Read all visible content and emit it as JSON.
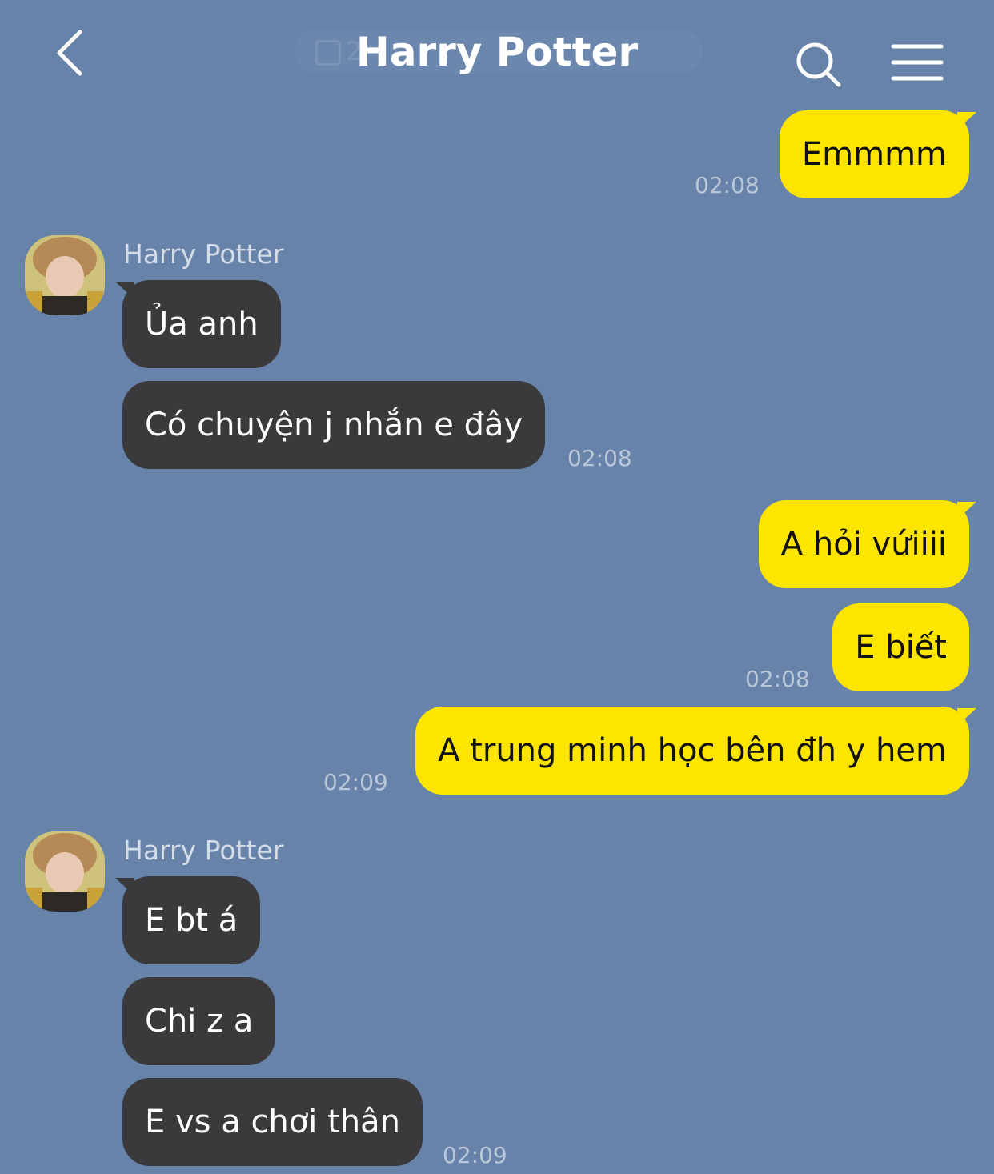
{
  "header": {
    "title": "Harry Potter",
    "date_hint": "2",
    "back_icon": "chevron-left-icon",
    "search_icon": "search-icon",
    "menu_icon": "hamburger-menu-icon"
  },
  "colors": {
    "background": "#6783aa",
    "outgoing_bubble": "#fee500",
    "incoming_bubble": "#3a3a3d"
  },
  "messages": [
    {
      "text": "Emmmm",
      "time": "02:08"
    },
    {
      "sender": "Harry Potter",
      "text": "Ủa anh"
    },
    {
      "text": "Có chuyện j nhắn e đây",
      "time": "02:08"
    },
    {
      "text": "A hỏi vứiiii"
    },
    {
      "text": "E biết",
      "time": "02:08"
    },
    {
      "text": "A trung minh học bên đh y hem",
      "time": "02:09"
    },
    {
      "sender": "Harry Potter",
      "text": "E bt á"
    },
    {
      "text": "Chi z a"
    },
    {
      "text": "E vs a chơi thân",
      "time": "02:09"
    }
  ]
}
